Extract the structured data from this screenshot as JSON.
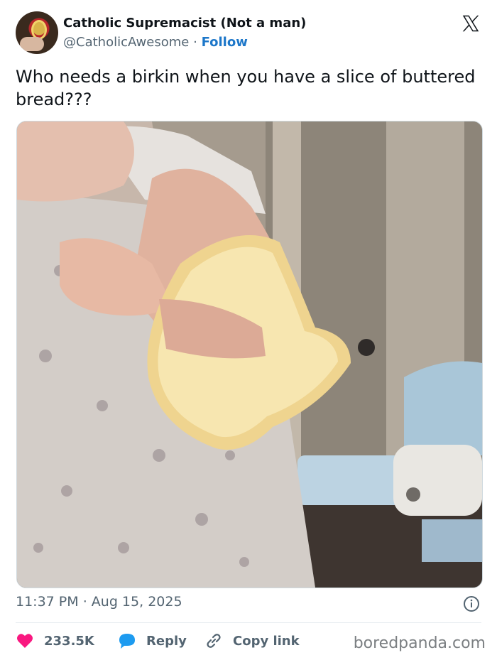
{
  "tweet": {
    "display_name": "Catholic Supremacist (Not a man)",
    "handle": "@CatholicAwesome",
    "separator": "·",
    "follow_label": "Follow",
    "text": "Who needs a birkin when you have a slice of buttered bread???",
    "time": "11:37 PM",
    "date": "Aug 15, 2025"
  },
  "actions": {
    "likes": "233.5K",
    "reply_label": "Reply",
    "copy_link_label": "Copy link"
  },
  "icons": {
    "platform": "x-logo-icon",
    "info": "info-icon",
    "like": "heart-icon",
    "reply": "speech-bubble-icon",
    "copy": "link-icon"
  },
  "colors": {
    "follow": "#1d77c9",
    "heart": "#f91880",
    "reply_bubble": "#1d9bf0",
    "muted": "#536471"
  },
  "watermark": "boredpanda.com"
}
